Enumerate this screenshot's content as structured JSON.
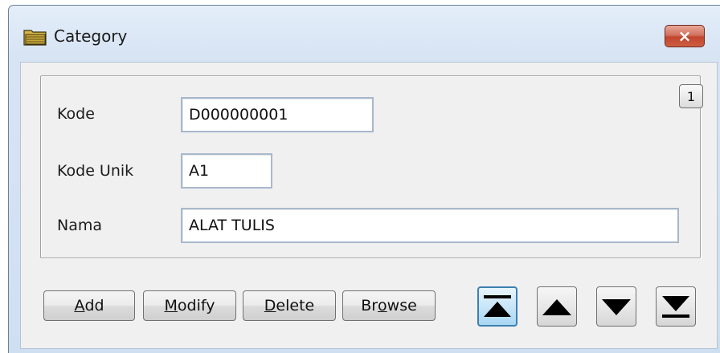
{
  "window": {
    "title": "Category",
    "close_label": "×"
  },
  "form": {
    "record_badge": "1",
    "fields": {
      "kode": {
        "label": "Kode",
        "value": "D000000001"
      },
      "kode_unik": {
        "label": "Kode Unik",
        "value": "A1"
      },
      "nama": {
        "label": "Nama",
        "value": "ALAT TULIS"
      }
    }
  },
  "toolbar": {
    "buttons": [
      {
        "mnemonic": "A",
        "rest": "dd"
      },
      {
        "mnemonic": "M",
        "rest": "odify"
      },
      {
        "mnemonic": "D",
        "rest": "elete"
      },
      {
        "prefix": "Br",
        "mnemonic": "o",
        "rest": "wse"
      }
    ],
    "navigation": [
      {
        "icon": "first-record-icon"
      },
      {
        "icon": "previous-record-icon"
      },
      {
        "icon": "next-record-icon"
      },
      {
        "icon": "last-record-icon"
      }
    ]
  }
}
